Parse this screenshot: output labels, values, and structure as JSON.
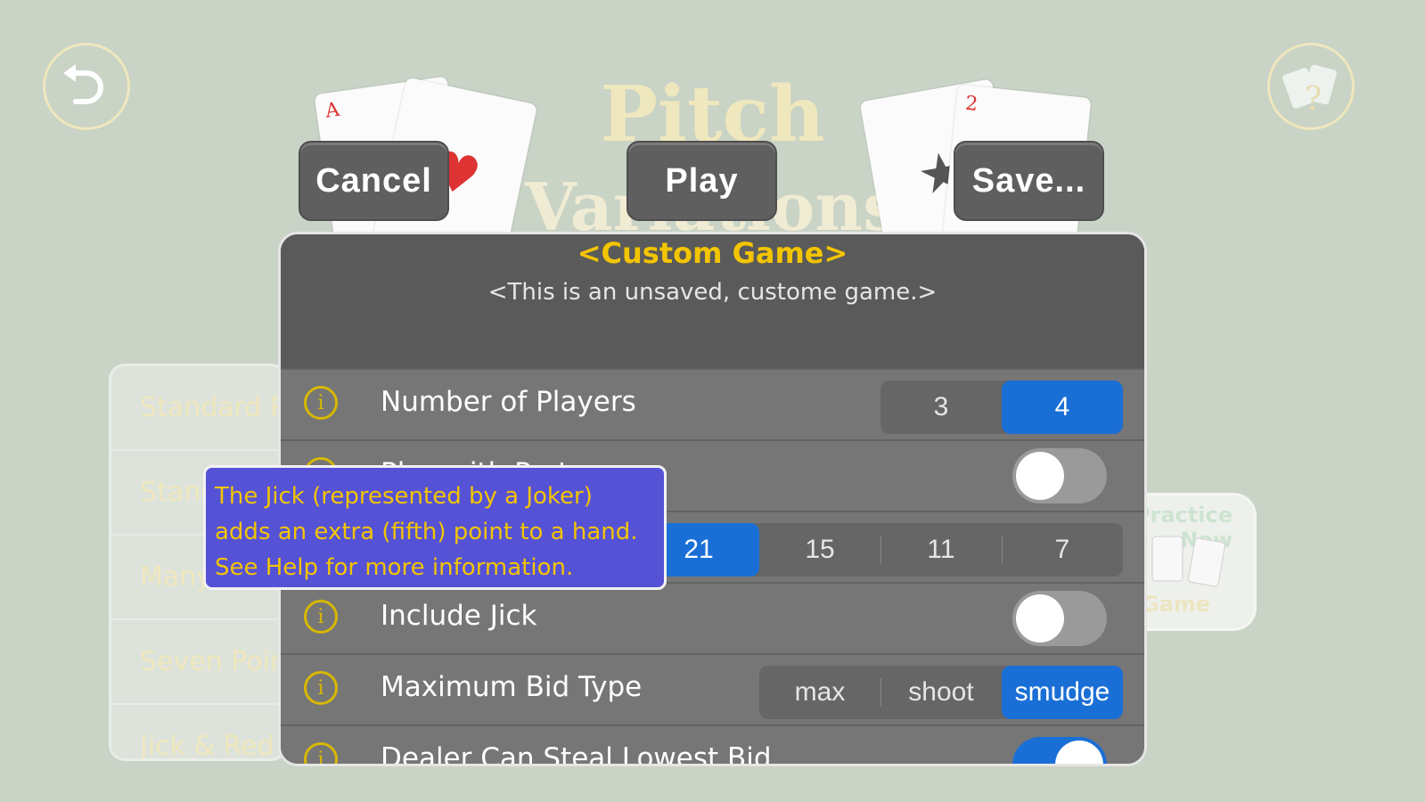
{
  "nav": {
    "back_icon": "undo-arrow-icon",
    "help_icon": "cards-help-icon",
    "help_mark": "?"
  },
  "header": {
    "title_line1": "Pitch",
    "title_line2": "Variations"
  },
  "buttons": {
    "cancel": "Cancel",
    "play": "Play",
    "save": "Save..."
  },
  "cards": {
    "left_rank": "A",
    "right_rank": "2"
  },
  "variations_list": [
    "Standard Pitch",
    "Standard",
    "Many",
    "Seven Point",
    "Jick & Red"
  ],
  "practice": {
    "top": "Practice Now",
    "bottom": "Game"
  },
  "panel": {
    "title": "<Custom Game>",
    "subtitle": "<This is an unsaved, custome game.>",
    "rows": {
      "players": {
        "label": "Number of Players",
        "options": [
          "3",
          "4"
        ],
        "selected": "4"
      },
      "partner": {
        "label": "Play with Partner",
        "toggle": "off"
      },
      "points": {
        "options": [
          "21",
          "15",
          "11",
          "7"
        ],
        "selected": "21"
      },
      "jick": {
        "label": "Include Jick",
        "toggle": "off"
      },
      "bid": {
        "label": "Maximum Bid Type",
        "options": [
          "max",
          "shoot",
          "smudge"
        ],
        "selected": "smudge"
      },
      "steal": {
        "label": "Dealer Can Steal Lowest Bid",
        "toggle": "on"
      }
    }
  },
  "tooltip": {
    "text": "The Jick (represented by a Joker) adds an extra (fifth) point to a hand. See Help for more information."
  },
  "colors": {
    "background": "#c9d3c6",
    "accent_blue": "#1a6fd6",
    "title_yellow": "#f3c400",
    "tooltip_bg": "#5552d6"
  }
}
